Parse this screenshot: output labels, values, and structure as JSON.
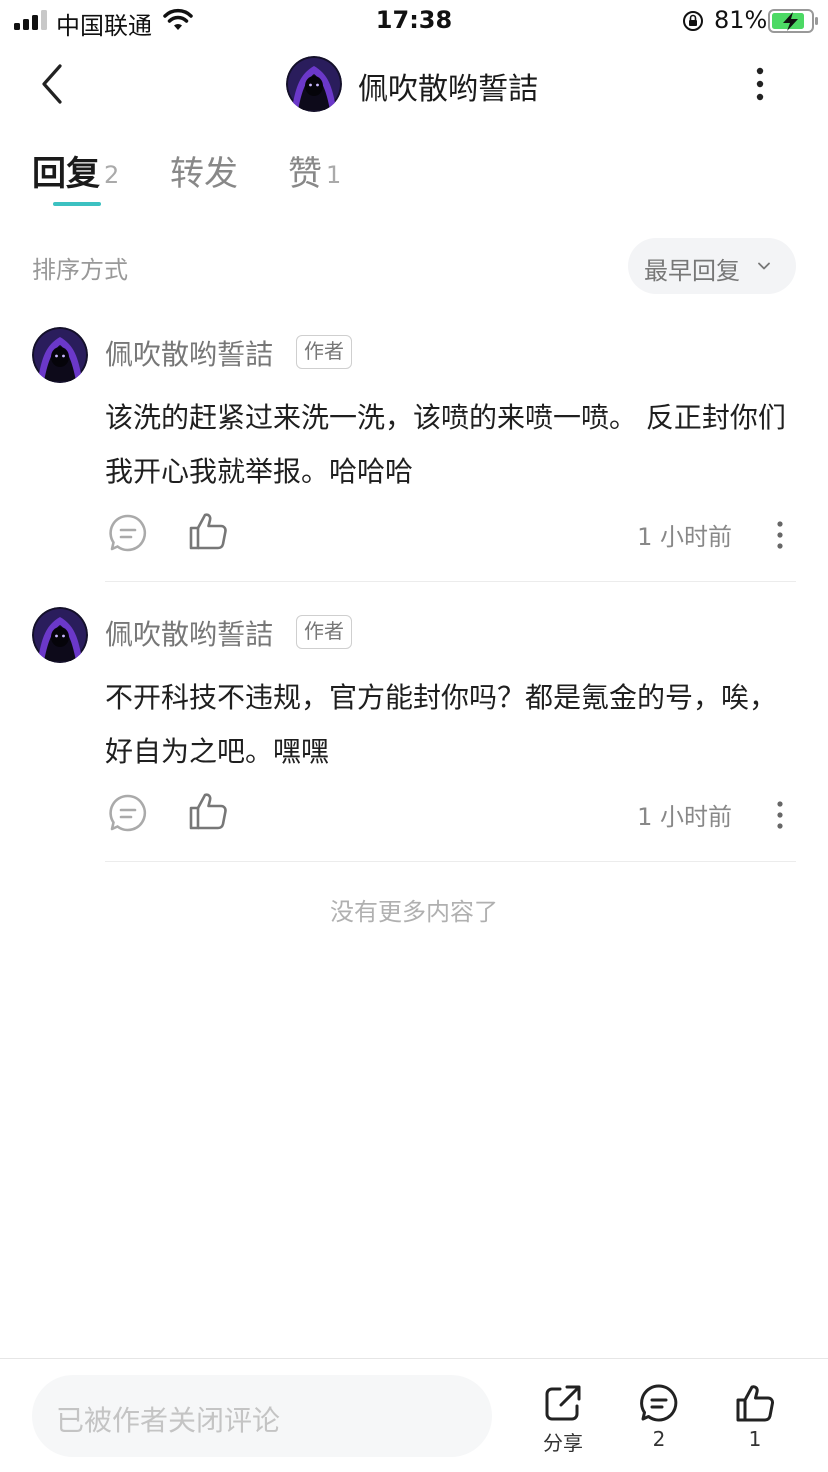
{
  "status_bar": {
    "carrier": "中国联通",
    "time": "17:38",
    "battery": "81%",
    "icons": [
      "signal-icon",
      "wifi-icon",
      "rotation-lock-icon",
      "battery-charging-icon"
    ]
  },
  "header": {
    "title": "佩吹散哟誓詰",
    "icons": [
      "back-icon",
      "avatar",
      "more-vertical-icon"
    ]
  },
  "tabs": [
    {
      "label": "回复",
      "count": "2",
      "active": true
    },
    {
      "label": "转发",
      "count": "",
      "active": false
    },
    {
      "label": "赞",
      "count": "1",
      "active": false
    }
  ],
  "accent_color": "#3cc1c1",
  "sort": {
    "label": "排序方式",
    "selected": "最早回复"
  },
  "comments": [
    {
      "author": "佩吹散哟誓詰",
      "badge": "作者",
      "text": "该洗的赶紧过来洗一洗，该喷的来喷一喷。 反正封你们我开心我就举报。哈哈哈",
      "time": "1 小时前"
    },
    {
      "author": "佩吹散哟誓詰",
      "badge": "作者",
      "text": "不开科技不违规，官方能封你吗？都是氪金的号，唉，好自为之吧。嘿嘿",
      "time": "1 小时前"
    }
  ],
  "no_more": "没有更多内容了",
  "bottom_bar": {
    "input_placeholder": "已被作者关闭评论",
    "share_label": "分享",
    "comment_count": "2",
    "like_count": "1"
  }
}
